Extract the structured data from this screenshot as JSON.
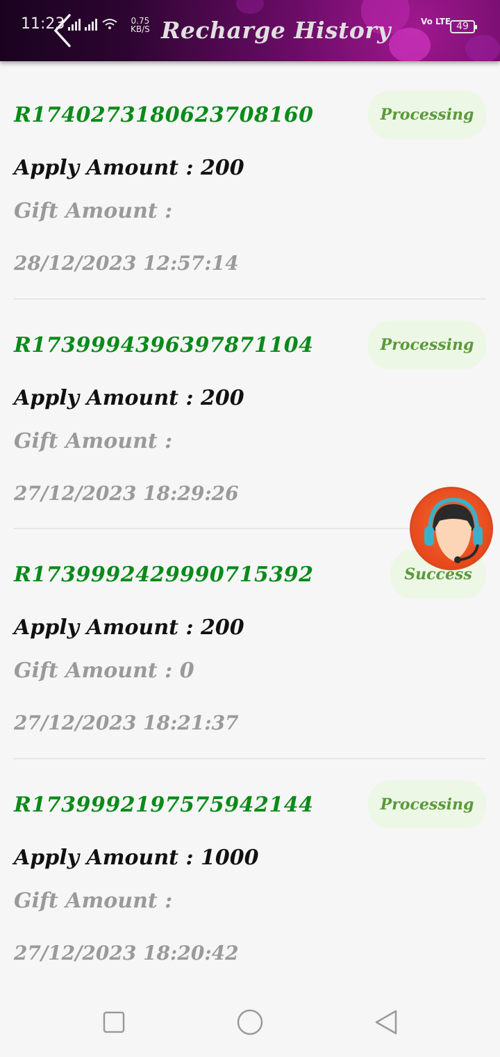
{
  "status_bar": {
    "time": "11:23",
    "speed_value": "0.75",
    "speed_unit": "KB/S",
    "network": "Vo LTE",
    "battery": "49"
  },
  "header": {
    "title": "Recharge History",
    "back_icon": "chevron-left-icon"
  },
  "records": [
    {
      "order_id": "R1740273180623708160",
      "status": "Processing",
      "apply_amount": "Apply Amount : 200",
      "gift_amount": "Gift Amount :",
      "datetime": "28/12/2023 12:57:14"
    },
    {
      "order_id": "R1739994396397871104",
      "status": "Processing",
      "apply_amount": "Apply Amount : 200",
      "gift_amount": "Gift Amount :",
      "datetime": "27/12/2023 18:29:26"
    },
    {
      "order_id": "R1739992429990715392",
      "status": "Success",
      "apply_amount": "Apply Amount : 200",
      "gift_amount": "Gift Amount : 0",
      "datetime": "27/12/2023 18:21:37"
    },
    {
      "order_id": "R1739992197575942144",
      "status": "Processing",
      "apply_amount": "Apply Amount : 1000",
      "gift_amount": "Gift Amount :",
      "datetime": "27/12/2023 18:20:42"
    }
  ],
  "support_button": {
    "icon": "customer-support-icon"
  },
  "nav_bar": {
    "recents_icon": "square-icon",
    "home_icon": "circle-icon",
    "back_icon": "triangle-back-icon"
  },
  "colors": {
    "order_id": "#0a8a1a",
    "status_text": "#5a9a3a",
    "status_bg": "#edf7e6",
    "apply_text": "#111111",
    "muted_text": "#9a9a9a",
    "header_accent": "#a0188f"
  }
}
